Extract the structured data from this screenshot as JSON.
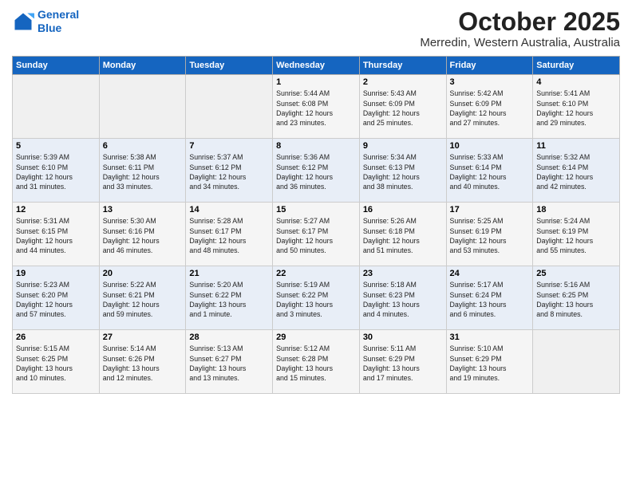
{
  "logo": {
    "line1": "General",
    "line2": "Blue"
  },
  "title": "October 2025",
  "subtitle": "Merredin, Western Australia, Australia",
  "days_of_week": [
    "Sunday",
    "Monday",
    "Tuesday",
    "Wednesday",
    "Thursday",
    "Friday",
    "Saturday"
  ],
  "weeks": [
    [
      {
        "day": "",
        "info": ""
      },
      {
        "day": "",
        "info": ""
      },
      {
        "day": "",
        "info": ""
      },
      {
        "day": "1",
        "info": "Sunrise: 5:44 AM\nSunset: 6:08 PM\nDaylight: 12 hours\nand 23 minutes."
      },
      {
        "day": "2",
        "info": "Sunrise: 5:43 AM\nSunset: 6:09 PM\nDaylight: 12 hours\nand 25 minutes."
      },
      {
        "day": "3",
        "info": "Sunrise: 5:42 AM\nSunset: 6:09 PM\nDaylight: 12 hours\nand 27 minutes."
      },
      {
        "day": "4",
        "info": "Sunrise: 5:41 AM\nSunset: 6:10 PM\nDaylight: 12 hours\nand 29 minutes."
      }
    ],
    [
      {
        "day": "5",
        "info": "Sunrise: 5:39 AM\nSunset: 6:10 PM\nDaylight: 12 hours\nand 31 minutes."
      },
      {
        "day": "6",
        "info": "Sunrise: 5:38 AM\nSunset: 6:11 PM\nDaylight: 12 hours\nand 33 minutes."
      },
      {
        "day": "7",
        "info": "Sunrise: 5:37 AM\nSunset: 6:12 PM\nDaylight: 12 hours\nand 34 minutes."
      },
      {
        "day": "8",
        "info": "Sunrise: 5:36 AM\nSunset: 6:12 PM\nDaylight: 12 hours\nand 36 minutes."
      },
      {
        "day": "9",
        "info": "Sunrise: 5:34 AM\nSunset: 6:13 PM\nDaylight: 12 hours\nand 38 minutes."
      },
      {
        "day": "10",
        "info": "Sunrise: 5:33 AM\nSunset: 6:14 PM\nDaylight: 12 hours\nand 40 minutes."
      },
      {
        "day": "11",
        "info": "Sunrise: 5:32 AM\nSunset: 6:14 PM\nDaylight: 12 hours\nand 42 minutes."
      }
    ],
    [
      {
        "day": "12",
        "info": "Sunrise: 5:31 AM\nSunset: 6:15 PM\nDaylight: 12 hours\nand 44 minutes."
      },
      {
        "day": "13",
        "info": "Sunrise: 5:30 AM\nSunset: 6:16 PM\nDaylight: 12 hours\nand 46 minutes."
      },
      {
        "day": "14",
        "info": "Sunrise: 5:28 AM\nSunset: 6:17 PM\nDaylight: 12 hours\nand 48 minutes."
      },
      {
        "day": "15",
        "info": "Sunrise: 5:27 AM\nSunset: 6:17 PM\nDaylight: 12 hours\nand 50 minutes."
      },
      {
        "day": "16",
        "info": "Sunrise: 5:26 AM\nSunset: 6:18 PM\nDaylight: 12 hours\nand 51 minutes."
      },
      {
        "day": "17",
        "info": "Sunrise: 5:25 AM\nSunset: 6:19 PM\nDaylight: 12 hours\nand 53 minutes."
      },
      {
        "day": "18",
        "info": "Sunrise: 5:24 AM\nSunset: 6:19 PM\nDaylight: 12 hours\nand 55 minutes."
      }
    ],
    [
      {
        "day": "19",
        "info": "Sunrise: 5:23 AM\nSunset: 6:20 PM\nDaylight: 12 hours\nand 57 minutes."
      },
      {
        "day": "20",
        "info": "Sunrise: 5:22 AM\nSunset: 6:21 PM\nDaylight: 12 hours\nand 59 minutes."
      },
      {
        "day": "21",
        "info": "Sunrise: 5:20 AM\nSunset: 6:22 PM\nDaylight: 13 hours\nand 1 minute."
      },
      {
        "day": "22",
        "info": "Sunrise: 5:19 AM\nSunset: 6:22 PM\nDaylight: 13 hours\nand 3 minutes."
      },
      {
        "day": "23",
        "info": "Sunrise: 5:18 AM\nSunset: 6:23 PM\nDaylight: 13 hours\nand 4 minutes."
      },
      {
        "day": "24",
        "info": "Sunrise: 5:17 AM\nSunset: 6:24 PM\nDaylight: 13 hours\nand 6 minutes."
      },
      {
        "day": "25",
        "info": "Sunrise: 5:16 AM\nSunset: 6:25 PM\nDaylight: 13 hours\nand 8 minutes."
      }
    ],
    [
      {
        "day": "26",
        "info": "Sunrise: 5:15 AM\nSunset: 6:25 PM\nDaylight: 13 hours\nand 10 minutes."
      },
      {
        "day": "27",
        "info": "Sunrise: 5:14 AM\nSunset: 6:26 PM\nDaylight: 13 hours\nand 12 minutes."
      },
      {
        "day": "28",
        "info": "Sunrise: 5:13 AM\nSunset: 6:27 PM\nDaylight: 13 hours\nand 13 minutes."
      },
      {
        "day": "29",
        "info": "Sunrise: 5:12 AM\nSunset: 6:28 PM\nDaylight: 13 hours\nand 15 minutes."
      },
      {
        "day": "30",
        "info": "Sunrise: 5:11 AM\nSunset: 6:29 PM\nDaylight: 13 hours\nand 17 minutes."
      },
      {
        "day": "31",
        "info": "Sunrise: 5:10 AM\nSunset: 6:29 PM\nDaylight: 13 hours\nand 19 minutes."
      },
      {
        "day": "",
        "info": ""
      }
    ]
  ]
}
